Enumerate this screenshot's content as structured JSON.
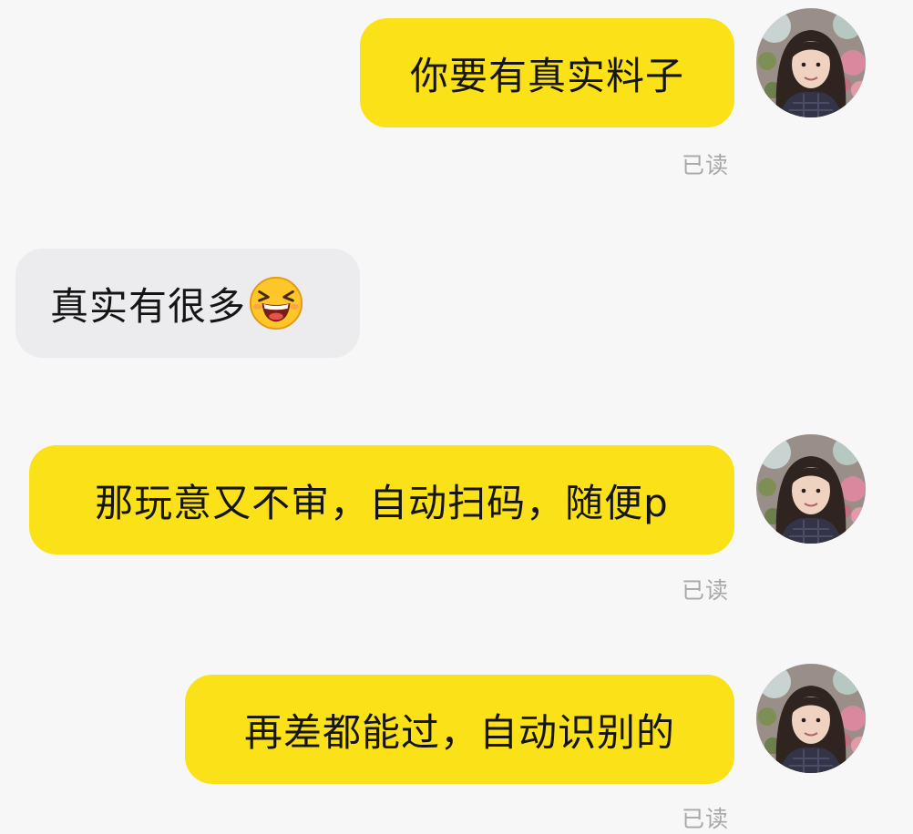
{
  "conversation": {
    "messages": [
      {
        "direction": "outgoing",
        "text": "你要有真实料子",
        "status": "已读"
      },
      {
        "direction": "incoming",
        "text": "真实有很多",
        "emoji": "laughing-squint-emoji"
      },
      {
        "direction": "outgoing",
        "text": "那玩意又不审，自动扫码，随便p",
        "status": "已读"
      },
      {
        "direction": "outgoing",
        "text": "再差都能过，自动识别的",
        "status": "已读"
      }
    ]
  },
  "icons": {
    "avatar": "woman-portrait-avatar",
    "emoji": "laughing-squint-emoji"
  },
  "colors": {
    "background": "#f7f7f7",
    "outgoing_bubble": "#fbe118",
    "incoming_bubble": "#ececee",
    "status_text": "#a8a8a8",
    "emoji_face": "#ffc62a"
  }
}
